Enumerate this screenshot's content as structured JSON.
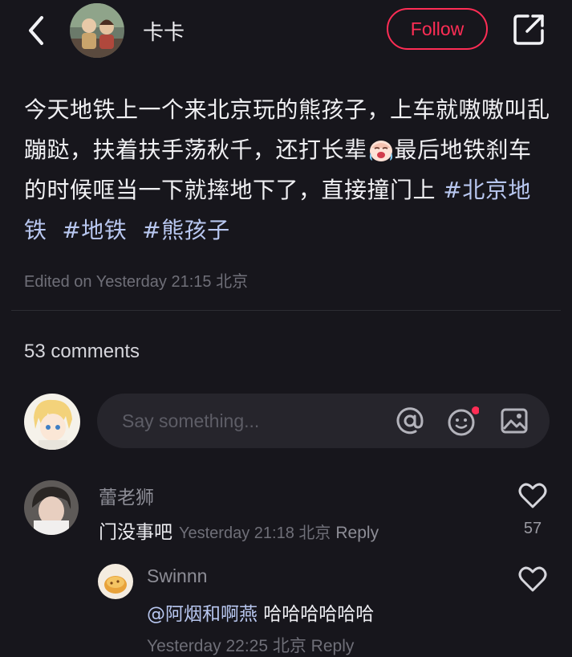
{
  "header": {
    "username": "卡卡",
    "follow_label": "Follow"
  },
  "post": {
    "text_before_emoji": "今天地铁上一个来北京玩的熊孩子，上车就嗷嗷叫乱蹦跶，扶着扶手荡秋千，还打长辈",
    "emoji": "crying-face",
    "text_after_emoji": "最后地铁刹车的时候哐当一下就摔地下了，直接撞门上 ",
    "hashtags": [
      "#北京地铁",
      "#地铁",
      "#熊孩子"
    ],
    "meta": "Edited on Yesterday 21:15 北京"
  },
  "comments_section": {
    "count_label": "53 comments",
    "input_placeholder": "Say something...",
    "icons": [
      "at-icon",
      "emoji-icon",
      "image-icon"
    ],
    "comments": [
      {
        "author": "蕾老狮",
        "text": "门没事吧",
        "time": "Yesterday 21:18 北京",
        "reply_label": "Reply",
        "likes": "57"
      }
    ],
    "replies": [
      {
        "author": "Swinnn",
        "mention": "@阿烟和啊燕",
        "text": " 哈哈哈哈哈哈",
        "time_partial": "Yesterday 22:25 北京  Reply"
      }
    ]
  },
  "colors": {
    "background": "#17161c",
    "accent": "#ff2d55",
    "tag": "#b8c7f0"
  }
}
